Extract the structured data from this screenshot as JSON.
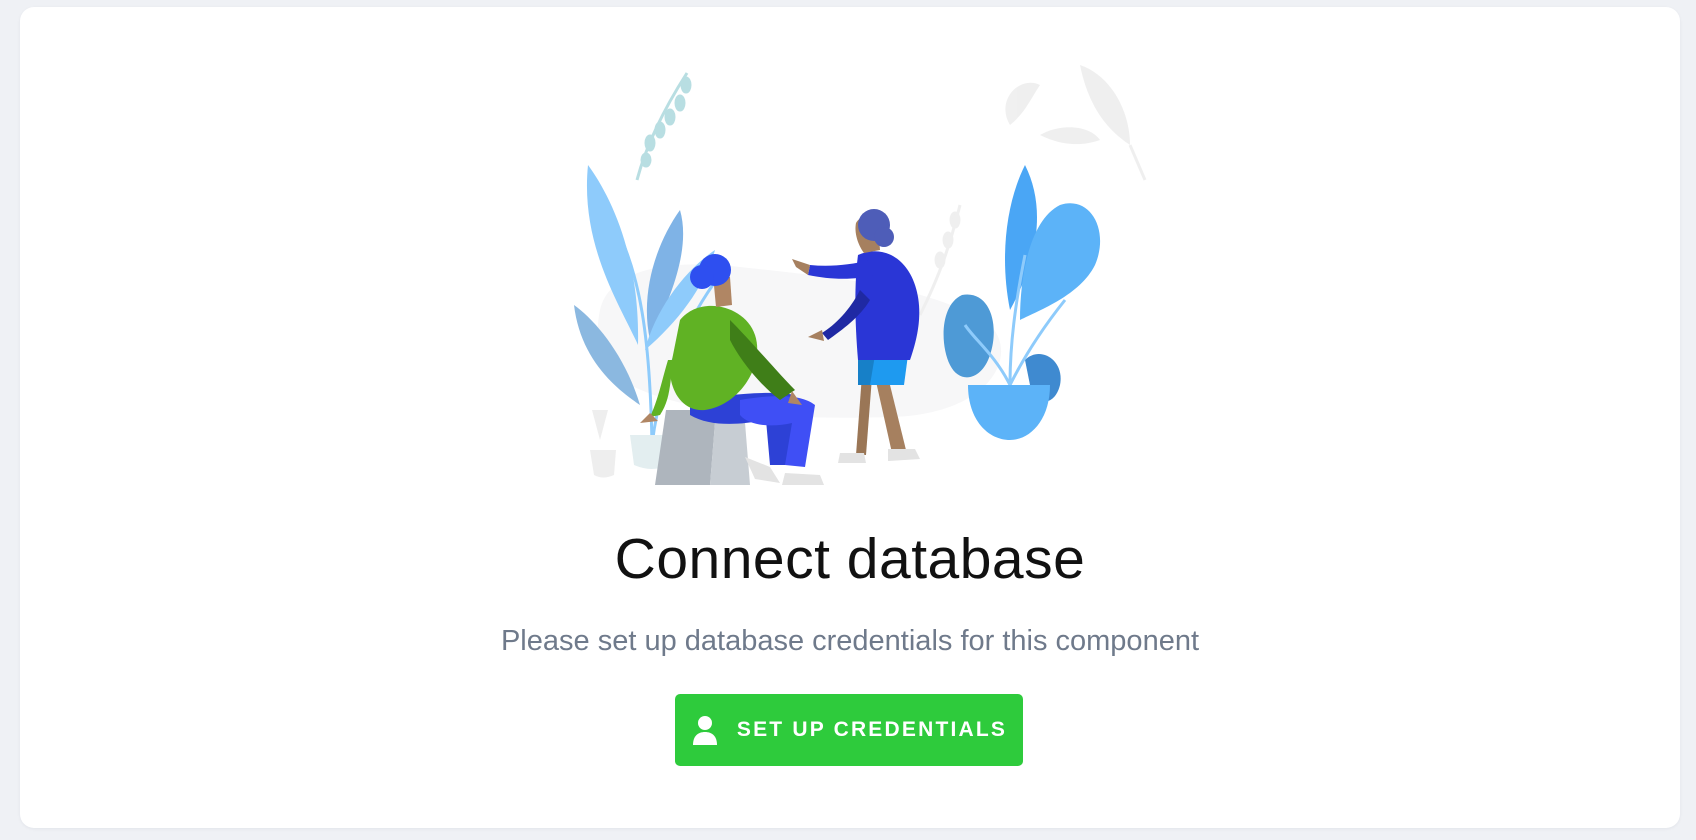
{
  "main": {
    "title": "Connect database",
    "subtitle": "Please set up database credentials for this component",
    "button": {
      "label": "SET UP CREDENTIALS",
      "icon": "user-icon"
    },
    "illustration": {
      "icon": "people-discussing-plants-illustration"
    }
  },
  "colors": {
    "page_background": "#eff1f5",
    "card_background": "#ffffff",
    "button_background": "#2ecb3c",
    "title_text": "#111111",
    "subtitle_text": "#6f7a8b"
  }
}
